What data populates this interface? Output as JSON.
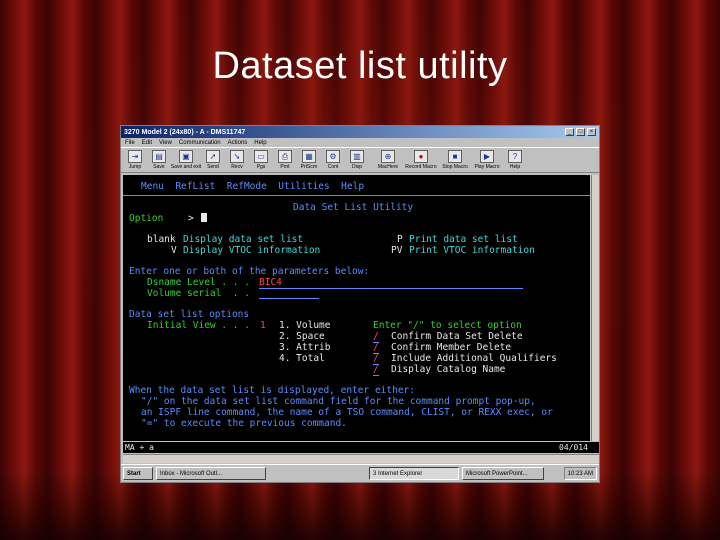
{
  "slide": {
    "title": "Dataset list utility"
  },
  "window": {
    "title": "3270 Model 2 (24x80) - A - DMS11747",
    "menu": [
      "File",
      "Edit",
      "View",
      "Communication",
      "Actions",
      "Help"
    ],
    "toolbar": [
      {
        "label": "Jump",
        "icon": "jump-icon",
        "glyph": "⇥"
      },
      {
        "label": "Save",
        "icon": "save-icon",
        "glyph": "▤"
      },
      {
        "label": "Save and exit",
        "icon": "save-exit-icon",
        "glyph": "▣"
      },
      {
        "label": "Send",
        "icon": "send-icon",
        "glyph": "➚"
      },
      {
        "label": "Recv",
        "icon": "receive-icon",
        "glyph": "➘"
      },
      {
        "label": "Pgs",
        "icon": "pages-icon",
        "glyph": "▭"
      },
      {
        "label": "Prnt",
        "icon": "print-icon",
        "glyph": "⎙"
      },
      {
        "label": "PrtScrn",
        "icon": "print-screen-icon",
        "glyph": "▦"
      },
      {
        "label": "Cont",
        "icon": "control-icon",
        "glyph": "⚙"
      },
      {
        "label": "Disp",
        "icon": "display-icon",
        "glyph": "▥"
      },
      {
        "label": "MacHere",
        "icon": "macro-icon",
        "glyph": "⊕"
      },
      {
        "label": "Record Macro",
        "icon": "record-macro-icon",
        "glyph": "●"
      },
      {
        "label": "Stop Macro",
        "icon": "stop-macro-icon",
        "glyph": "■"
      },
      {
        "label": "Play Macro",
        "icon": "play-macro-icon",
        "glyph": "▶"
      },
      {
        "label": "Help",
        "icon": "help-icon",
        "glyph": "?"
      }
    ]
  },
  "ispf": {
    "action_bar": "Menu  RefList  RefMode  Utilities  Help",
    "panel_title": "Data Set List Utility",
    "option_label": "Option",
    "option_prompt": ">",
    "blank_label": "blank",
    "blank_desc": "Display data set list",
    "p_key": "P",
    "p_desc": "Print data set list",
    "v_key": "V",
    "v_desc": "Display VTOC information",
    "pv_key": "PV",
    "pv_desc": "Print VTOC information",
    "params_heading": "Enter one or both of the parameters below:",
    "dsname_label": "Dsname Level . . .",
    "dsname_value": "BIC4",
    "volume_label": "Volume serial  . .",
    "options_heading": "Data set list options",
    "initial_view_label": "Initial View . . .",
    "initial_view_value": "1",
    "views": [
      "1. Volume",
      "2. Space",
      "3. Attrib",
      "4. Total"
    ],
    "select_heading": "Enter \"/\" to select option",
    "select_options": [
      {
        "mark": "/",
        "text": "Confirm Data Set Delete"
      },
      {
        "mark": "/",
        "text": "Confirm Member Delete"
      },
      {
        "mark": "/",
        "text": "Include Additional Qualifiers"
      },
      {
        "mark": "/",
        "text": "Display Catalog Name"
      }
    ],
    "help_line1": "When the data set list is displayed, enter either:",
    "help_line2": "\"/\" on the data set list command field for the command prompt pop-up,",
    "help_line3": "an ISPF line command, the name of a TSO command, CLIST, or REXX exec, or",
    "help_line4": "\"=\" to execute the previous command."
  },
  "status": {
    "left": "MA  +  a",
    "right": "04/014"
  },
  "taskbar": {
    "start": "Start",
    "tasks": [
      "Inbox - Microsoft Outl...",
      "3 Internet Explorer",
      "Microsoft PowerPoint..."
    ],
    "clock": "10:23 AM"
  }
}
